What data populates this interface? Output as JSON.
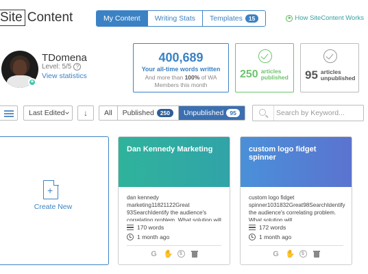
{
  "logo": {
    "part1": "Site",
    "part2": "Content"
  },
  "top_tabs": [
    {
      "label": "My Content",
      "active": true
    },
    {
      "label": "Writing Stats",
      "active": false
    },
    {
      "label": "Templates",
      "badge": "15",
      "active": false
    }
  ],
  "help_link": "How SiteContent Works",
  "profile": {
    "username": "TDomena",
    "level": "Level: 5/5",
    "level_help": "?",
    "view_stats": "View statistics"
  },
  "stats": {
    "words": "400,689",
    "words_label": "Your all-time words written",
    "words_note_prefix": "And more than ",
    "words_note_pct": "100%",
    "words_note_suffix": " of WA Members this month",
    "published_count": "250",
    "published_label_1": "articles",
    "published_label_2": "published",
    "unpublished_count": "95",
    "unpublished_label_1": "articles",
    "unpublished_label_2": "unpublished"
  },
  "toolbar": {
    "sort_value": "Last Edited",
    "sort_dir_glyph": "↓",
    "filters": [
      {
        "label": "All",
        "active": false
      },
      {
        "label": "Published",
        "count": "250",
        "active": false
      },
      {
        "label": "Unpublished",
        "count": "95",
        "active": true
      }
    ],
    "search_placeholder": "Search by Keyword..."
  },
  "new_card": {
    "label": "Create New",
    "plus": "+"
  },
  "articles": [
    {
      "title": "Dan Kennedy Marketing",
      "excerpt": "dan kennedy marketing11821122Great 93SearchIdentify the audience's correlating problem. What solution will",
      "words": "170 words",
      "edited": "1 month ago"
    },
    {
      "title": "custom logo fidget spinner",
      "excerpt": "custom logo fidget spinner1031832Great98SearchIdentify the audience's correlating problem. What solution will",
      "words": "172 words",
      "edited": "1 month ago"
    }
  ],
  "card_actions": {
    "google_glyph": "G",
    "circle_glyph": "$"
  },
  "colors": {
    "primary": "#3b82c4",
    "published_green": "#6cc46c",
    "teal_header": "#2fb39c",
    "blue_header": "#5b73cf"
  }
}
